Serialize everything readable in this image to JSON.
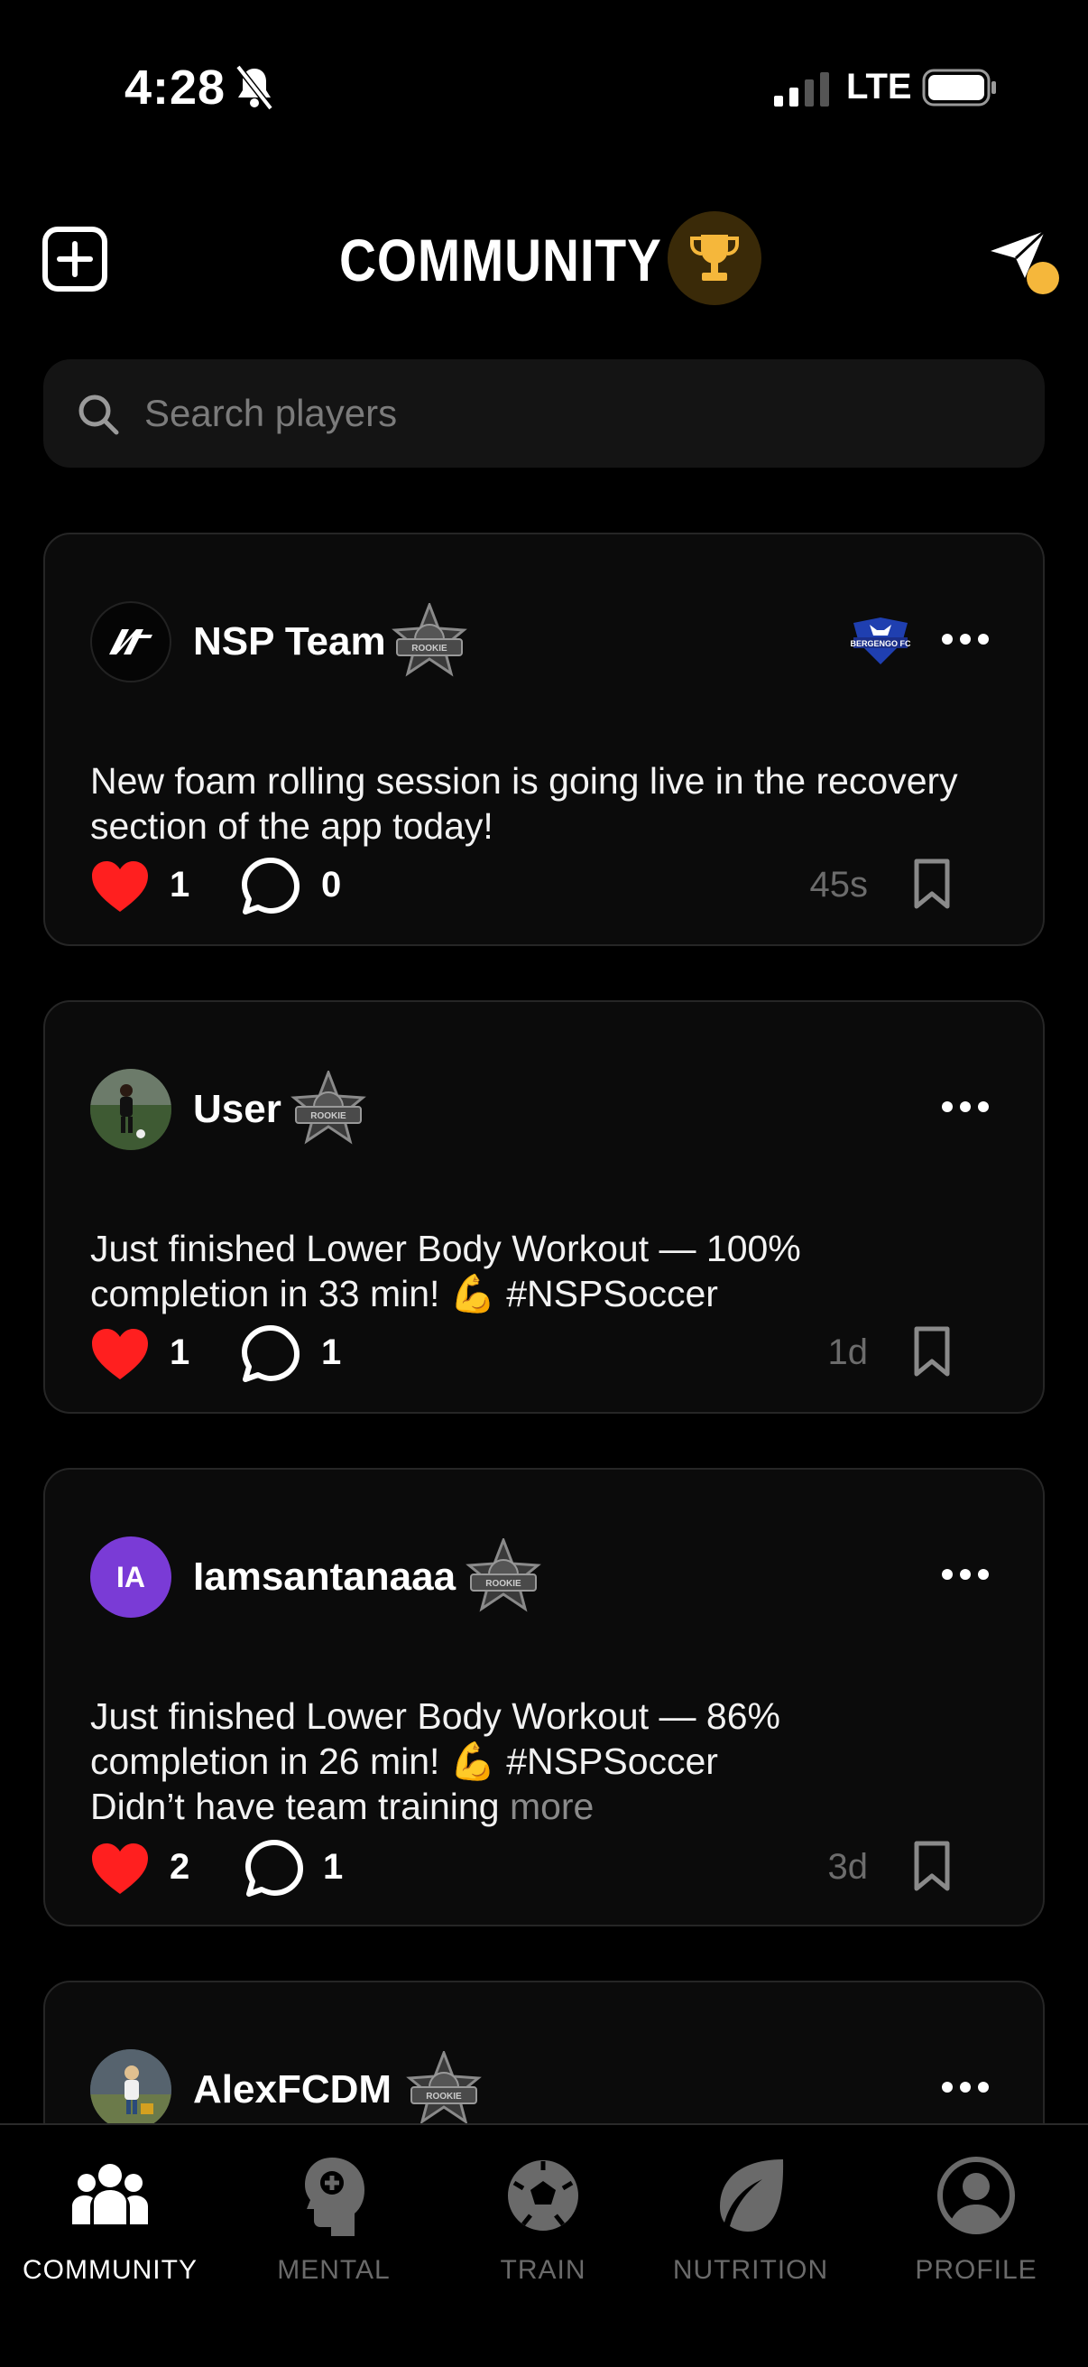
{
  "status_bar": {
    "time": "4:28",
    "network": "LTE"
  },
  "header": {
    "title": "COMMUNITY"
  },
  "search": {
    "placeholder": "Search players"
  },
  "posts": [
    {
      "author": "NSP Team",
      "badge": "ROOKIE",
      "team_logo_text": "BERGENGO FC",
      "text": "New foam rolling session is going live in the recovery section of the app today!",
      "likes": "1",
      "comments": "0",
      "time_ago": "45s"
    },
    {
      "author": "User",
      "badge": "ROOKIE",
      "text": "Just finished Lower Body Workout — 100% completion in 33 min! 💪 #NSPSoccer",
      "likes": "1",
      "comments": "1",
      "time_ago": "1d"
    },
    {
      "author": "Iamsantanaaa",
      "avatar_initials": "IA",
      "badge": "ROOKIE",
      "text_lines": [
        "Just finished Lower Body Workout — 86%",
        "completion in 26 min! 💪 #NSPSoccer",
        "Didn’t have team training"
      ],
      "more_label": "more",
      "likes": "2",
      "comments": "1",
      "time_ago": "3d"
    },
    {
      "author": "AlexFCDM",
      "badge": "ROOKIE"
    }
  ],
  "tabs": [
    {
      "label": "COMMUNITY",
      "icon": "community-icon",
      "active": true
    },
    {
      "label": "MENTAL",
      "icon": "mental-icon",
      "active": false
    },
    {
      "label": "TRAIN",
      "icon": "soccer-ball-icon",
      "active": false
    },
    {
      "label": "NUTRITION",
      "icon": "leaf-icon",
      "active": false
    },
    {
      "label": "PROFILE",
      "icon": "profile-icon",
      "active": false
    }
  ],
  "colors": {
    "accent": "#f5b73b",
    "like": "#ff1f1f",
    "avatar_ia": "#7a3bd6"
  }
}
